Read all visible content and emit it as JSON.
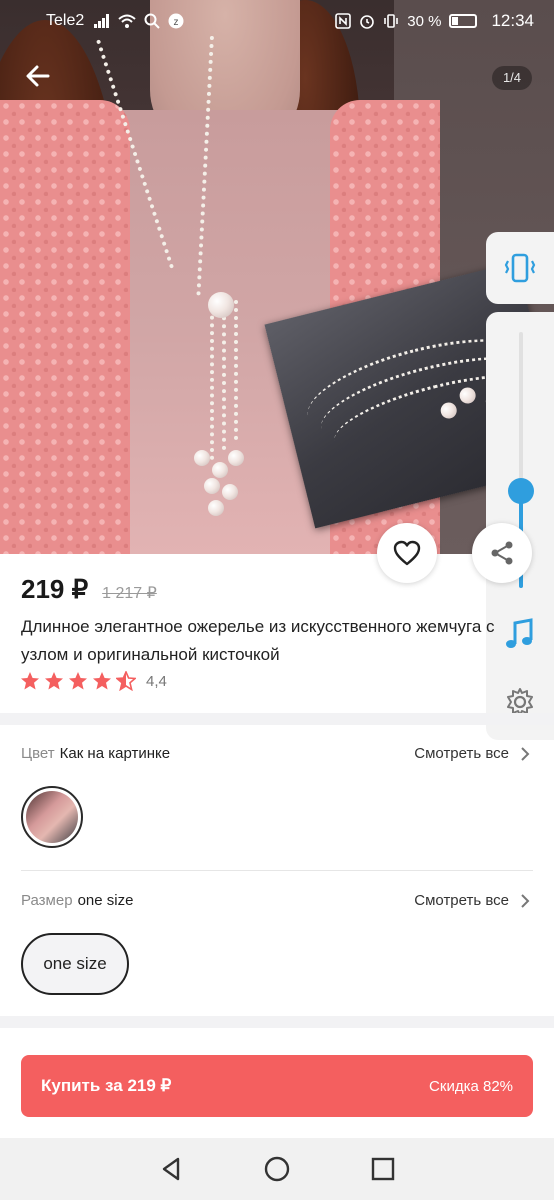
{
  "status_bar": {
    "carrier": "Tele2",
    "battery": "30 %",
    "time": "12:34"
  },
  "gallery": {
    "counter": "1/4"
  },
  "product": {
    "price": "219 ₽",
    "old_price": "1 217 ₽",
    "title": "Длинное элегантное ожерелье из искусственного жемчуга с узлом и оригинальной кисточкой",
    "rating": "4,4",
    "stars_filled": 4.5
  },
  "options": {
    "color": {
      "key": "Цвет",
      "value": "Как на картинке",
      "see_all": "Смотреть все"
    },
    "size": {
      "key": "Размер",
      "value": "one size",
      "see_all": "Смотреть все",
      "chip_label": "one size"
    }
  },
  "cta": {
    "label": "Купить за 219 ₽",
    "discount": "Скидка 82%"
  },
  "side_panel": {
    "volume_level": 0.38
  },
  "colors": {
    "accent": "#f45f5f",
    "star": "#f45f5f",
    "volume": "#2f9ede"
  },
  "icons": {
    "back": "arrow-left-icon",
    "favorite": "heart-icon",
    "share": "share-icon",
    "vibrate": "vibrate-icon",
    "music": "music-note-icon",
    "settings": "gear-icon",
    "chevron": "chevron-right-icon"
  }
}
